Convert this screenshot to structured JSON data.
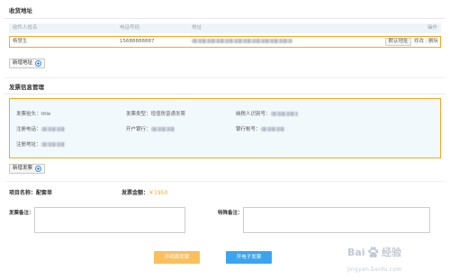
{
  "address_section": {
    "title": "收货地址",
    "columns": [
      "收件人姓名",
      "电话号码",
      "地址",
      "操作"
    ],
    "rows": [
      {
        "name": "杨慧生",
        "phone": "15688888887",
        "default_label": "默认地址",
        "edit_label": "修改",
        "action_separator": "|",
        "delete_label": "删除"
      }
    ],
    "add_button": {
      "label": "新增地址",
      "icon": "plus-circle-icon"
    }
  },
  "invoice_section": {
    "title": "发票信息管理",
    "fields": [
      {
        "label": "发票抬头：",
        "value": "title"
      },
      {
        "label": "发票类型：",
        "value": "增值税普通发票"
      },
      {
        "label": "纳税人识别号："
      },
      {
        "label": "注册电话："
      },
      {
        "label": "开户银行："
      },
      {
        "label": "银行帐号："
      },
      {
        "label": "注册地址："
      }
    ],
    "add_button": {
      "label": "新增发票",
      "icon": "plus-circle-icon"
    }
  },
  "order": {
    "project_label": "项目名称：",
    "project_value": "配套单",
    "amount_label": "发票金额：",
    "amount_value": "￥1950",
    "invoice_remark_label": "发票备注：",
    "special_remark_label": "特殊备注："
  },
  "actions": {
    "paper_invoice_label": "开纸质发票",
    "electronic_invoice_label": "开电子发票"
  },
  "watermark": {
    "brand_prefix": "Bai",
    "brand_suffix": "经验",
    "site": "jingyan.baidu.com",
    "icon": "baidu-paw-icon"
  },
  "colors": {
    "accent_orange": "#f5a623",
    "button_orange": "#fbbf5e",
    "button_blue": "#3ba4ef",
    "panel_bg": "#f2f9fd",
    "table_header_bg": "#eef5f9",
    "icon_blue": "#3d8fe0"
  }
}
